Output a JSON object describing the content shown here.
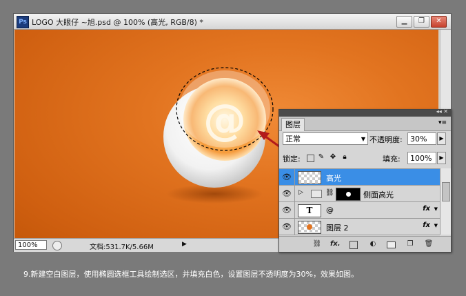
{
  "window": {
    "app_icon": "Ps",
    "title": "LOGO 大眼仔 ~旭.psd @ 100% (高光, RGB/8) *",
    "minimize_label": "▁",
    "restore_label": "❐",
    "close_label": "✕"
  },
  "status_bar": {
    "zoom": "100%",
    "doc_info": "文档:531.7K/5.66M",
    "arrow": "▶"
  },
  "layers_panel": {
    "collapse_label": "◂◂ ✕",
    "tab_label": "图层",
    "menu_icon": "▾≡",
    "blend_mode": "正常",
    "opacity_label": "不透明度:",
    "opacity_value": "30%",
    "lock_label": "锁定:",
    "fill_label": "填充:",
    "fill_value": "100%",
    "layers": [
      {
        "name": "高光",
        "selected": true
      },
      {
        "name": "侧面高光",
        "type": "group"
      },
      {
        "name": "@",
        "type": "text",
        "fx": "fx"
      },
      {
        "name": "图层 2",
        "fx": "fx"
      }
    ]
  },
  "caption": "9.新建空白图层，使用椭圆选框工具绘制选区，并填充白色，设置图层不透明度为30%，效果如图。",
  "colors": {
    "canvas_orange": "#e27420",
    "selection_blue": "#3a8ee6",
    "arrow_red": "#b31b1b"
  }
}
